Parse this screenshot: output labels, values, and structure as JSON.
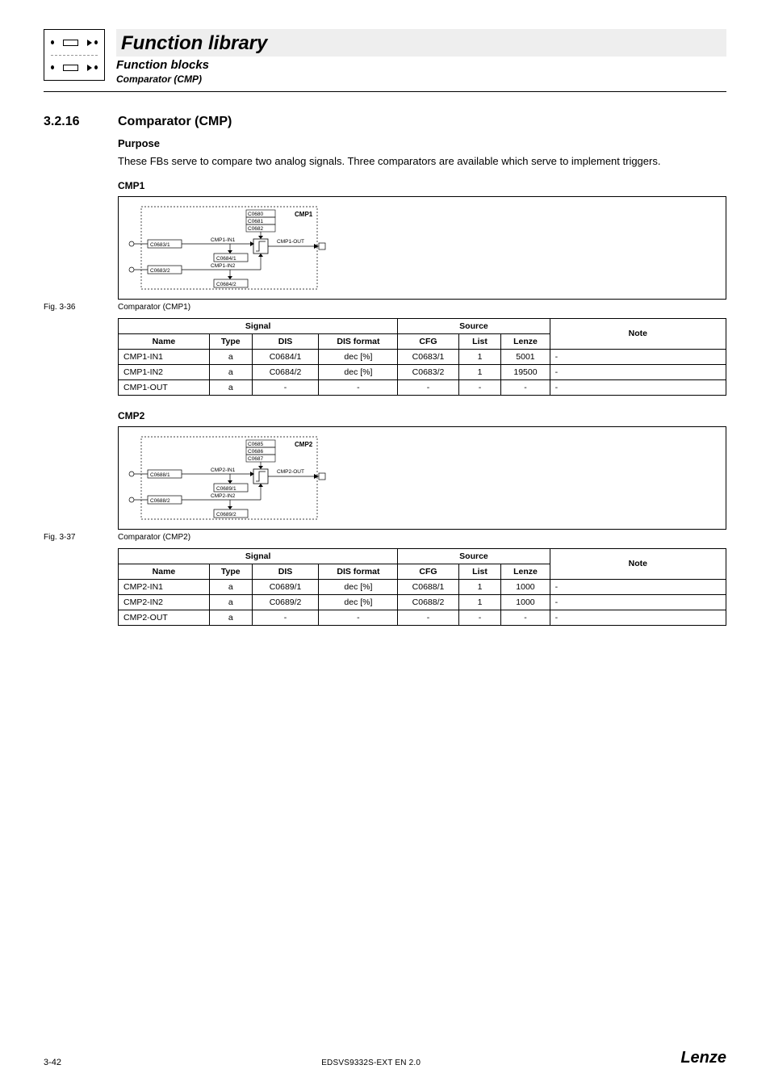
{
  "header": {
    "main": "Function library",
    "sub1": "Function blocks",
    "sub2": "Comparator (CMP)"
  },
  "section": {
    "num": "3.2.16",
    "title": "Comparator (CMP)",
    "purpose_h": "Purpose",
    "purpose_txt": "These FBs serve to compare two analog signals. Three comparators are available which serve to implement triggers."
  },
  "blocks": [
    {
      "title": "CMP1",
      "fig_label": "Fig. 3-36",
      "fig_caption": "Comparator (CMP1)",
      "diagram": {
        "name": "CMP1",
        "params": [
          "C0680",
          "C0681",
          "C0682"
        ],
        "in1_cfg": "C0683/1",
        "in1_lbl": "CMP1-IN1",
        "in1_disp": "C0684/1",
        "in2_cfg": "C0683/2",
        "in2_lbl": "CMP1-IN2",
        "in2_disp": "C0684/2",
        "out_lbl": "CMP1-OUT"
      },
      "table": {
        "headers": {
          "signal": "Signal",
          "source": "Source",
          "note": "Note",
          "name": "Name",
          "type": "Type",
          "dis": "DIS",
          "disf": "DIS format",
          "cfg": "CFG",
          "list": "List",
          "lenze": "Lenze"
        },
        "rows": [
          {
            "name": "CMP1-IN1",
            "type": "a",
            "dis": "C0684/1",
            "disf": "dec [%]",
            "cfg": "C0683/1",
            "list": "1",
            "lenze": "5001",
            "note": "-"
          },
          {
            "name": "CMP1-IN2",
            "type": "a",
            "dis": "C0684/2",
            "disf": "dec [%]",
            "cfg": "C0683/2",
            "list": "1",
            "lenze": "19500",
            "note": "-"
          },
          {
            "name": "CMP1-OUT",
            "type": "a",
            "dis": "-",
            "disf": "-",
            "cfg": "-",
            "list": "-",
            "lenze": "-",
            "note": "-"
          }
        ]
      }
    },
    {
      "title": "CMP2",
      "fig_label": "Fig. 3-37",
      "fig_caption": "Comparator (CMP2)",
      "diagram": {
        "name": "CMP2",
        "params": [
          "C0685",
          "C0686",
          "C0687"
        ],
        "in1_cfg": "C0688/1",
        "in1_lbl": "CMP2-IN1",
        "in1_disp": "C0689/1",
        "in2_cfg": "C0688/2",
        "in2_lbl": "CMP2-IN2",
        "in2_disp": "C0689/2",
        "out_lbl": "CMP2-OUT"
      },
      "table": {
        "headers": {
          "signal": "Signal",
          "source": "Source",
          "note": "Note",
          "name": "Name",
          "type": "Type",
          "dis": "DIS",
          "disf": "DIS format",
          "cfg": "CFG",
          "list": "List",
          "lenze": "Lenze"
        },
        "rows": [
          {
            "name": "CMP2-IN1",
            "type": "a",
            "dis": "C0689/1",
            "disf": "dec [%]",
            "cfg": "C0688/1",
            "list": "1",
            "lenze": "1000",
            "note": "-"
          },
          {
            "name": "CMP2-IN2",
            "type": "a",
            "dis": "C0689/2",
            "disf": "dec [%]",
            "cfg": "C0688/2",
            "list": "1",
            "lenze": "1000",
            "note": "-"
          },
          {
            "name": "CMP2-OUT",
            "type": "a",
            "dis": "-",
            "disf": "-",
            "cfg": "-",
            "list": "-",
            "lenze": "-",
            "note": "-"
          }
        ]
      }
    }
  ],
  "footer": {
    "page": "3-42",
    "doc": "EDSVS9332S-EXT EN 2.0",
    "brand": "Lenze"
  }
}
